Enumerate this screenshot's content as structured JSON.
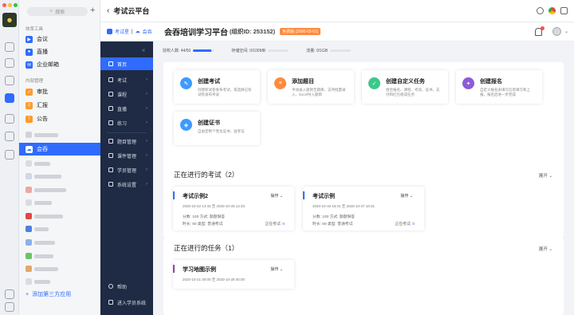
{
  "panel": {
    "search_placeholder": "搜索",
    "group_office": "效率工具",
    "group_internal": "内部管理",
    "apps_office": [
      {
        "label": "会议",
        "color": "#2f6bff"
      },
      {
        "label": "直播",
        "color": "#2f6bff"
      },
      {
        "label": "企业邮箱",
        "color": "#2f6bff"
      }
    ],
    "apps_internal": [
      {
        "label": "审批",
        "color": "#ff9a2e"
      },
      {
        "label": "汇报",
        "color": "#ff9a2e"
      },
      {
        "label": "公告",
        "color": "#ff9a2e"
      }
    ],
    "selected_app": "会吞",
    "add_app": "添加第三方应用"
  },
  "window": {
    "title": "考试云平台"
  },
  "header": {
    "logo_a": "考试星",
    "logo_b": "会吞",
    "page_title": "会吞培训学习平台",
    "org_id": "(组织ID: 253152)",
    "badge": "免费版 (2000-03-01)"
  },
  "nav": {
    "items": [
      {
        "label": "首页",
        "arrow": ""
      },
      {
        "label": "考试",
        "arrow": "›"
      },
      {
        "label": "课程",
        "arrow": "›"
      },
      {
        "label": "直播",
        "arrow": "›"
      },
      {
        "label": "练习",
        "arrow": "›"
      },
      {
        "label": "题目管理",
        "arrow": "›"
      },
      {
        "label": "课件管理",
        "arrow": "›"
      },
      {
        "label": "学员管理",
        "arrow": "›"
      },
      {
        "label": "系统设置",
        "arrow": "›"
      }
    ],
    "help": "帮助",
    "enter_student": "进入学员系统"
  },
  "stats": {
    "users_label": "授权人数: 44/50",
    "users_fill": 0.88,
    "storage_label": "存储空间: 0/100MB",
    "storage_fill": 0.0,
    "traffic_label": "流量: 0/1GB",
    "traffic_fill": 0.0
  },
  "quick": [
    {
      "title": "创建考试",
      "desc": "创建新试卷发布考试，或选择已有试卷发布考试",
      "color": "#3d9bff",
      "icon": "✎"
    },
    {
      "title": "添加题目",
      "desc": "手动录入题目至题库，支持批量录入、Excel导入题目",
      "color": "#ff8a3d",
      "icon": "≡"
    },
    {
      "title": "创建自定义任务",
      "desc": "组合报名、课程、考试、证书、支付和红包组成任务",
      "color": "#3cc88a",
      "icon": "✓"
    },
    {
      "title": "创建报名",
      "desc": "自定义报名表填写信息填写和上报，报名后进一步完成",
      "color": "#8e5bd8",
      "icon": "✦"
    },
    {
      "title": "创建证书",
      "desc": "自由定制个性化证书、准考证",
      "color": "#3d9bff",
      "icon": "◈"
    }
  ],
  "exams_section": {
    "title": "正在进行的考试（2）",
    "expand": "展开",
    "cards": [
      {
        "name": "考试示例2",
        "op": "操作",
        "time": "2020-10-22 14:33 至 2020-10-25 14:33",
        "meta1": "分数: 100   方式: 题题限答",
        "meta2": "时长: 60    类型: 普通考试",
        "now_label": "正在考试:",
        "now_value": "0"
      },
      {
        "name": "考试示例",
        "op": "操作",
        "time": "2020-10-18 16:31 至 2020-10-27 16:31",
        "meta1": "分数: 100   方式: 题题限答",
        "meta2": "时长: 60    类型: 普通考试",
        "now_label": "正在考试:",
        "now_value": "0"
      }
    ]
  },
  "tasks_section": {
    "title": "正在进行的任务（1）",
    "expand": "展开",
    "cards": [
      {
        "name": "学习地图示例",
        "op": "操作",
        "time": "2020-10-21 00:00 至 2020-10-28 00:00"
      }
    ]
  }
}
